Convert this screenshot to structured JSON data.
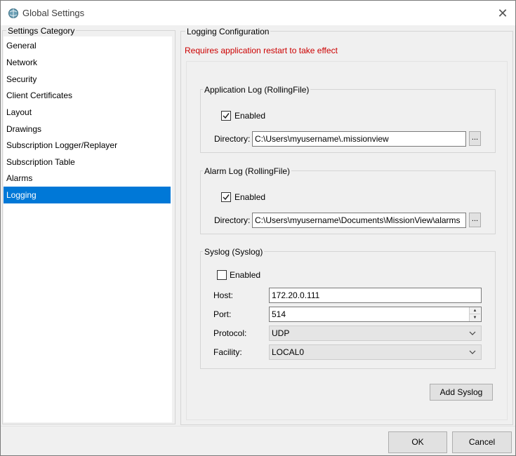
{
  "window": {
    "title": "Global Settings"
  },
  "sidebar": {
    "legend": "Settings Category",
    "items": [
      {
        "label": "General"
      },
      {
        "label": "Network"
      },
      {
        "label": "Security"
      },
      {
        "label": "Client Certificates"
      },
      {
        "label": "Layout"
      },
      {
        "label": "Drawings"
      },
      {
        "label": "Subscription Logger/Replayer"
      },
      {
        "label": "Subscription Table"
      },
      {
        "label": "Alarms"
      },
      {
        "label": "Logging",
        "selected": true
      }
    ]
  },
  "main": {
    "legend": "Logging Configuration",
    "warning": "Requires application restart to take effect",
    "app_log": {
      "legend": "Application Log (RollingFile)",
      "enabled_label": "Enabled",
      "enabled": true,
      "directory_label": "Directory:",
      "directory_value": "C:\\Users\\myusername\\.missionview",
      "browse_label": "..."
    },
    "alarm_log": {
      "legend": "Alarm Log (RollingFile)",
      "enabled_label": "Enabled",
      "enabled": true,
      "directory_label": "Directory:",
      "directory_value": "C:\\Users\\myusername\\Documents\\MissionView\\alarms",
      "browse_label": "..."
    },
    "syslog": {
      "legend": "Syslog (Syslog)",
      "enabled_label": "Enabled",
      "enabled": false,
      "host_label": "Host:",
      "host_value": "172.20.0.111",
      "port_label": "Port:",
      "port_value": "514",
      "protocol_label": "Protocol:",
      "protocol_value": "UDP",
      "facility_label": "Facility:",
      "facility_value": "LOCAL0"
    },
    "add_syslog_label": "Add Syslog"
  },
  "footer": {
    "ok_label": "OK",
    "cancel_label": "Cancel"
  },
  "colors": {
    "selection": "#0078d7",
    "warning": "#cc0000"
  },
  "icons": {
    "app": "globe-gear-icon",
    "close": "close-icon",
    "check": "check-icon",
    "chevron": "chevron-down-icon"
  }
}
